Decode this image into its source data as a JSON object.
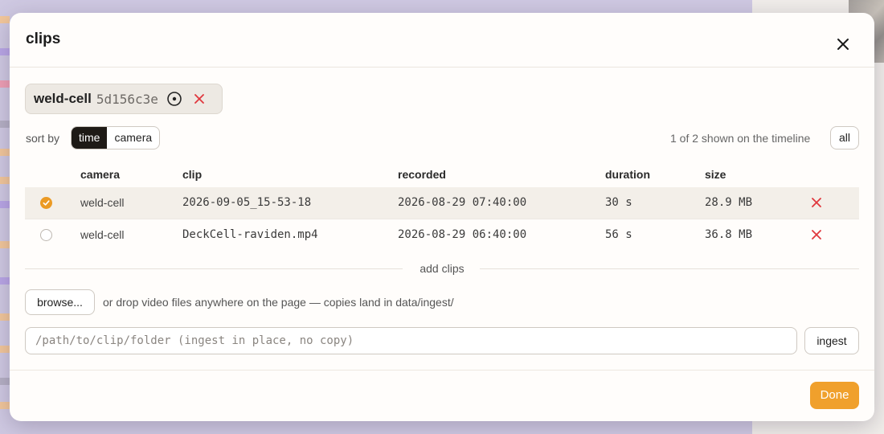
{
  "dialog": {
    "title": "clips"
  },
  "camera_chip": {
    "name": "weld-cell",
    "id": "5d156c3e"
  },
  "sort": {
    "label": "sort by",
    "options": [
      "time",
      "camera"
    ],
    "selected": "time"
  },
  "timeline_info": "1 of 2 shown on the timeline",
  "all_button": "all",
  "table": {
    "headers": [
      "camera",
      "clip",
      "recorded",
      "duration",
      "size"
    ],
    "rows": [
      {
        "camera": "weld-cell",
        "clip": "2026-09-05_15-53-18",
        "recorded": "2026-08-29 07:40:00",
        "duration": "30 s",
        "size": "28.9 MB",
        "shown": true
      },
      {
        "camera": "weld-cell",
        "clip": "DeckCell-raviden.mp4",
        "recorded": "2026-08-29 06:40:00",
        "duration": "56 s",
        "size": "36.8 MB",
        "shown": false
      }
    ]
  },
  "add_clips": {
    "label": "add clips",
    "browse_label": "browse...",
    "drop_hint": "or drop video files anywhere on the page — copies land in data/ingest/",
    "path_placeholder": "/path/to/clip/folder (ingest in place, no copy)",
    "ingest_label": "ingest"
  },
  "done_label": "Done",
  "colors": {
    "accent": "#f0a02c",
    "remove": "#e0383e",
    "segment_active": "#1e1a16"
  }
}
